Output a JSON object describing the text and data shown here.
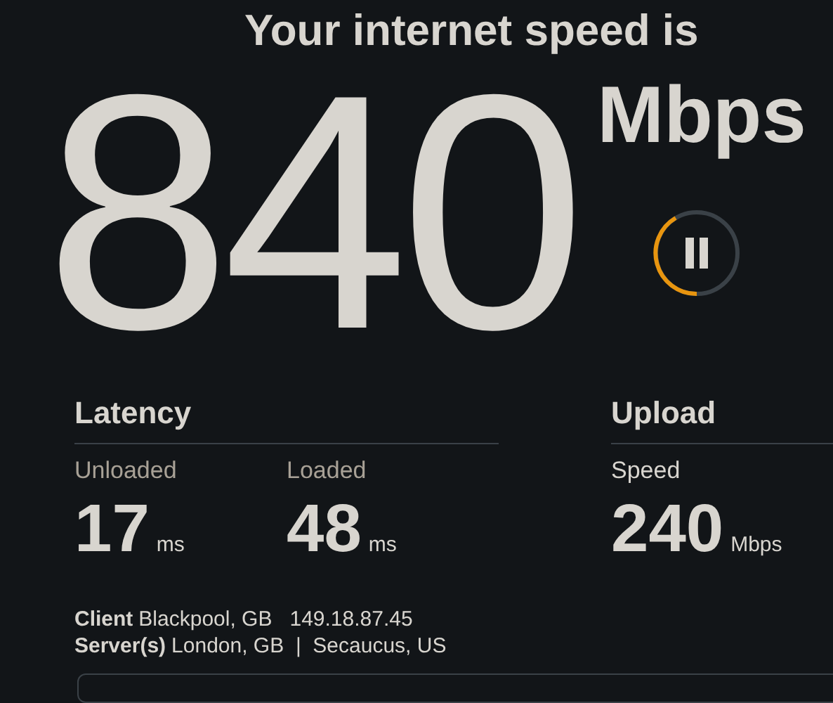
{
  "title": "Your internet speed is",
  "speed": {
    "value": "840",
    "unit": "Mbps"
  },
  "control": {
    "kind": "pause"
  },
  "latency": {
    "title": "Latency",
    "metrics": [
      {
        "label": "Unloaded",
        "value": "17",
        "unit": "ms"
      },
      {
        "label": "Loaded",
        "value": "48",
        "unit": "ms"
      }
    ]
  },
  "upload": {
    "title": "Upload",
    "metrics": [
      {
        "label": "Speed",
        "value": "240",
        "unit": "Mbps"
      }
    ]
  },
  "info": [
    {
      "label": "Client",
      "value": "Blackpool, GB   149.18.87.45"
    },
    {
      "label": "Server(s)",
      "value": "London, GB  |  Secaucus, US"
    }
  ]
}
